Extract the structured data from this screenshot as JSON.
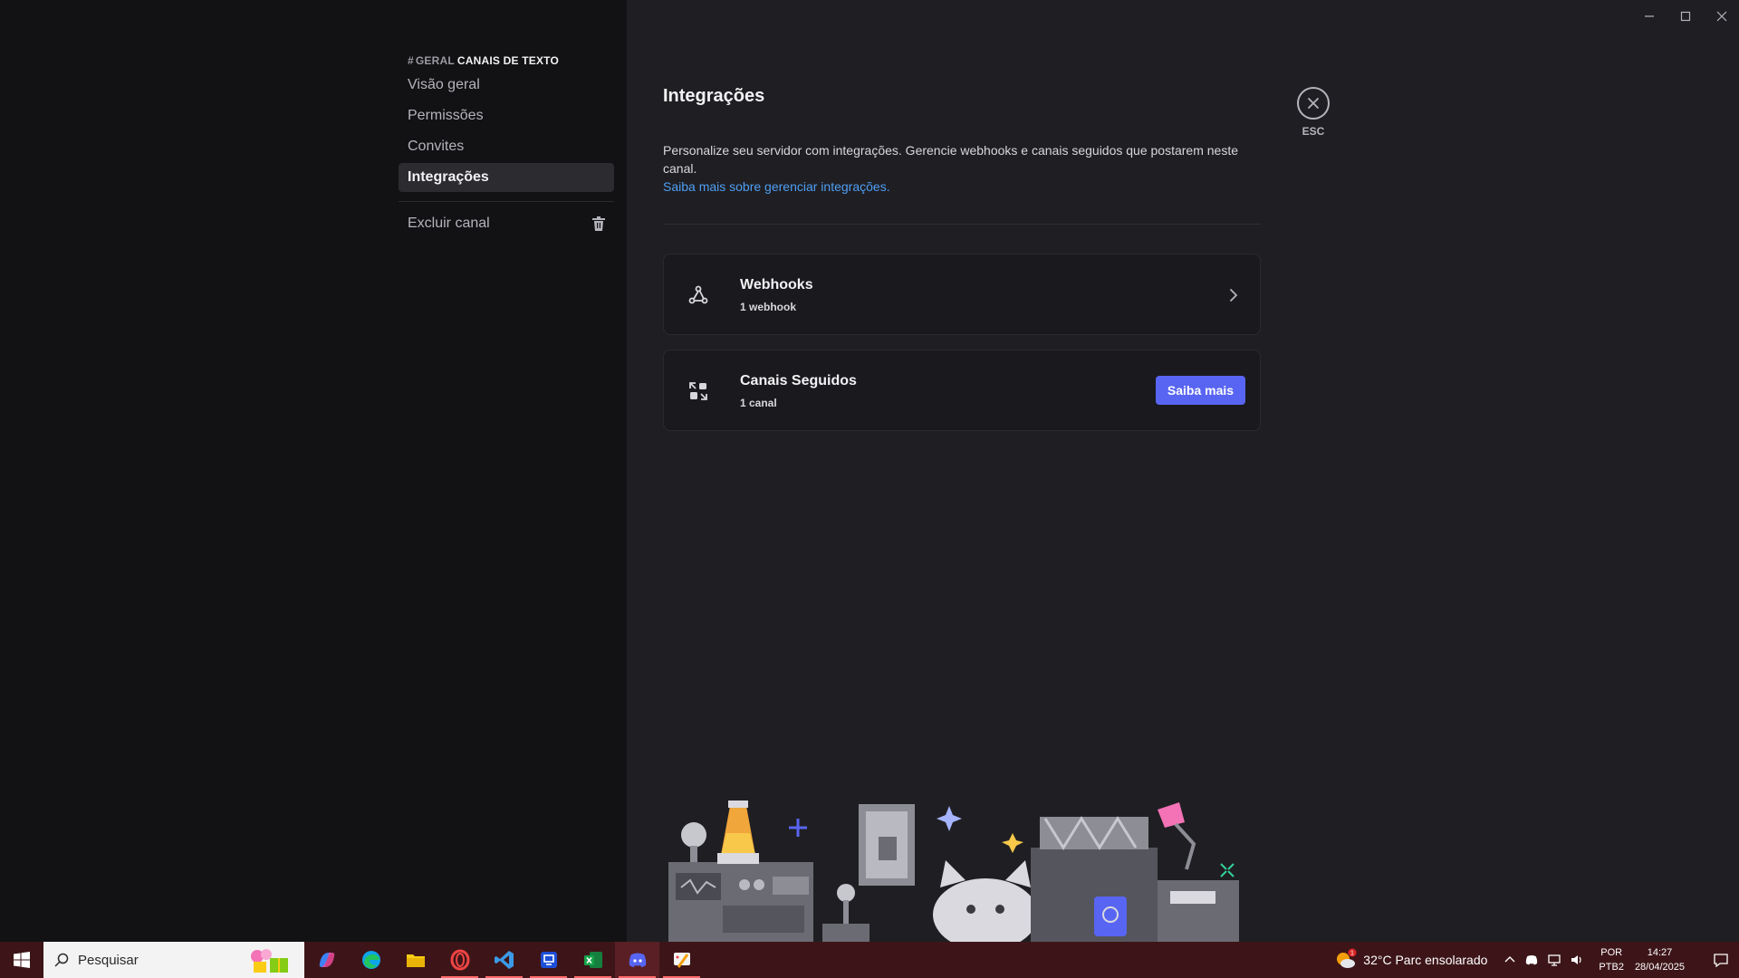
{
  "sidebar": {
    "header_hash": "#",
    "header_channel": "GERAL",
    "header_category": "CANAIS DE TEXTO",
    "items": [
      {
        "label": "Visão geral"
      },
      {
        "label": "Permissões"
      },
      {
        "label": "Convites"
      },
      {
        "label": "Integrações"
      }
    ],
    "delete_label": "Excluir canal"
  },
  "main": {
    "title": "Integrações",
    "description": "Personalize seu servidor com integrações. Gerencie webhooks e canais seguidos que postarem neste canal.",
    "learn_more_link": "Saiba mais sobre gerenciar integrações.",
    "cards": [
      {
        "title": "Webhooks",
        "subtitle": "1 webhook",
        "icon": "webhook-icon"
      },
      {
        "title": "Canais Seguidos",
        "subtitle": "1 canal",
        "icon": "follow-channel-icon",
        "button": "Saiba mais"
      }
    ],
    "close_label": "ESC"
  },
  "colors": {
    "sidebar_bg": "#121214",
    "content_bg": "#1f1f23",
    "accent": "#5865f2",
    "link": "#4f9ef4",
    "taskbar_bg": "#3d1518"
  },
  "taskbar": {
    "search_placeholder": "Pesquisar",
    "apps": [
      "copilot-icon",
      "edge-icon",
      "file-explorer-icon",
      "opera-icon",
      "vscode-icon",
      "remote-desktop-icon",
      "excel-icon",
      "discord-icon",
      "paint-icon"
    ],
    "weather": "32°C  Parc ensolarado",
    "weather_badge": "1",
    "lang_line1": "POR",
    "lang_line2": "PTB2",
    "time": "14:27",
    "date": "28/04/2025"
  }
}
